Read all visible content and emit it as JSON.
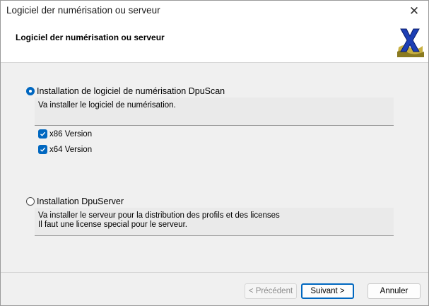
{
  "window": {
    "title": "Logiciel der numérisation ou serveur",
    "close_glyph": "✕"
  },
  "header": {
    "title": "Logiciel der numérisation ou serveur",
    "logo_icon": "x-logo-icon"
  },
  "options": {
    "scan": {
      "label": "Installation de logiciel de numérisation DpuScan",
      "selected": true,
      "description": "Va installer le logiciel de numérisation.",
      "checkboxes": [
        {
          "label": "x86 Version",
          "checked": true
        },
        {
          "label": "x64 Version",
          "checked": true
        }
      ]
    },
    "server": {
      "label": "Installation DpuServer",
      "selected": false,
      "description_line1": "Va installer le serveur pour la distribution des profils et des licenses",
      "description_line2": "Il faut une license special pour le serveur."
    }
  },
  "buttons": {
    "back": "< Précédent",
    "next": "Suivant >",
    "cancel": "Annuler"
  },
  "colors": {
    "accent": "#0067c0"
  }
}
